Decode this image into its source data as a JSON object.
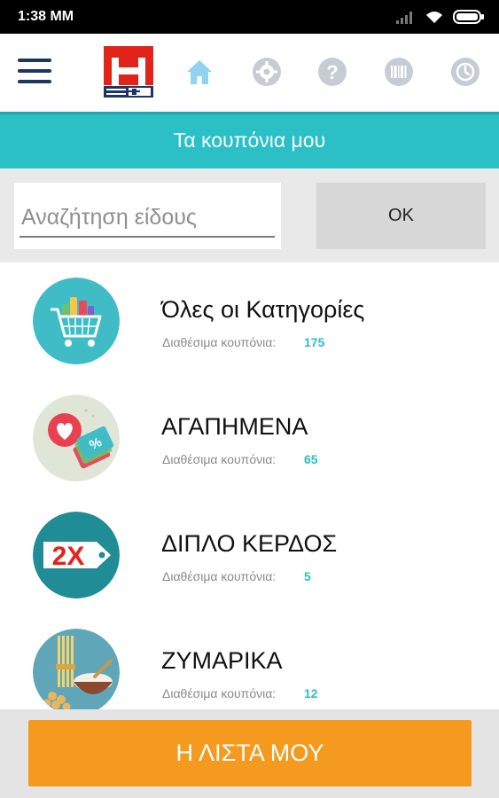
{
  "status_bar": {
    "time": "1:38 MM"
  },
  "app_bar": {
    "icons": [
      "menu-icon",
      "home-icon",
      "settings-icon",
      "help-icon",
      "barcode-icon",
      "history-icon"
    ],
    "active_color": "#8fd3f0",
    "inactive_color": "#c6ccd4"
  },
  "page": {
    "title": "Τα κουπόνια μου"
  },
  "search": {
    "placeholder": "Αναζήτηση είδους",
    "value": "",
    "ok_label": "ΟΚ"
  },
  "categories": [
    {
      "name": "Όλες οι Κατηγορίες",
      "available_label": "Διαθέσιμα κουπόνια:",
      "count": "175"
    },
    {
      "name": "ΑΓΑΠΗΜΕΝΑ",
      "available_label": "Διαθέσιμα κουπόνια:",
      "count": "65"
    },
    {
      "name": "ΔΙΠΛΟ ΚΕΡΔΟΣ",
      "available_label": "Διαθέσιμα κουπόνια:",
      "count": "5"
    },
    {
      "name": "ΖΥΜΑΡΙΚΑ",
      "available_label": "Διαθέσιμα κουπόνια:",
      "count": "12"
    }
  ],
  "footer": {
    "my_list_label": "Η ΛΙΣΤΑ ΜΟΥ"
  },
  "colors": {
    "accent": "#2bbfc6",
    "brand_red": "#e2231a",
    "brand_blue": "#1d3563",
    "button_orange": "#f39a1f"
  }
}
